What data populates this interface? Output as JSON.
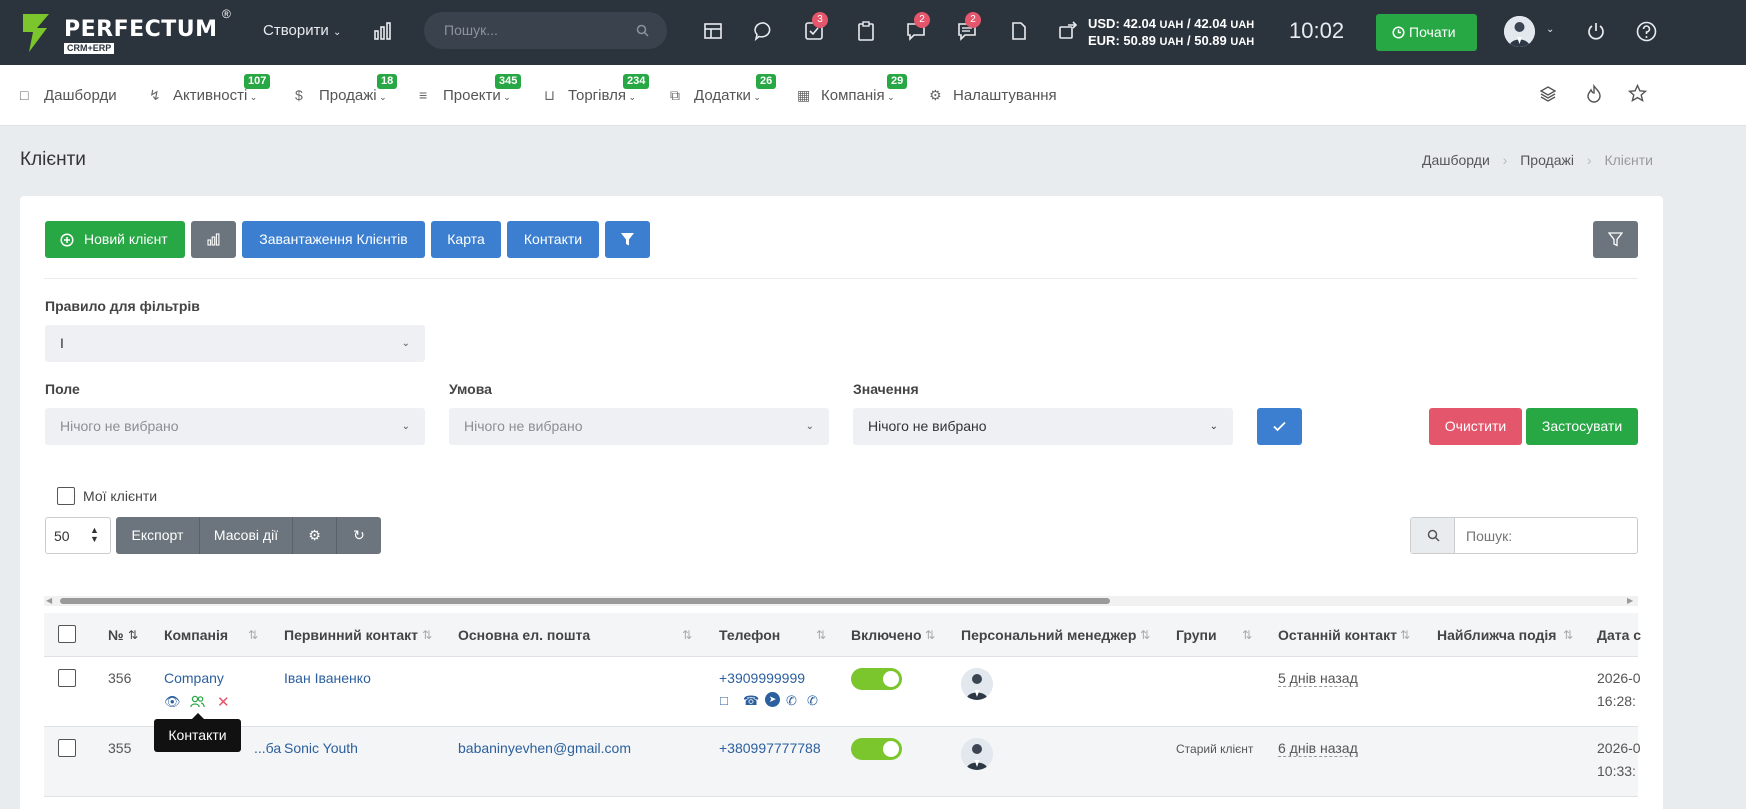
{
  "brand": {
    "name": "PERFECTUM",
    "reg": "®",
    "sub": "CRM+ERP",
    "color": "#7bc62d"
  },
  "topbar": {
    "create_label": "Створити",
    "search_placeholder": "Пошук...",
    "badges": {
      "tasks": "3",
      "messages": "2",
      "chat": "2"
    },
    "rates": {
      "usd": "USD: 42.04",
      "usd_unit": "UAH",
      "usd_sep": " / 42.04 ",
      "eur": "EUR: 50.89",
      "eur_sep": " / 50.89 "
    },
    "clock": "10:02",
    "start_label": "Почати"
  },
  "nav": {
    "items": [
      {
        "label": "Дашборди",
        "badge": ""
      },
      {
        "label": "Активності",
        "badge": "107"
      },
      {
        "label": "Продажі",
        "badge": "18"
      },
      {
        "label": "Проекти",
        "badge": "345"
      },
      {
        "label": "Торгівля",
        "badge": "234"
      },
      {
        "label": "Додатки",
        "badge": "26"
      },
      {
        "label": "Компанія",
        "badge": "29"
      },
      {
        "label": "Налаштування",
        "badge": ""
      }
    ]
  },
  "page": {
    "title": "Клієнти",
    "breadcrumb": [
      "Дашборди",
      "Продажі",
      "Клієнти"
    ]
  },
  "toolbar": {
    "new_client": "Новий клієнт",
    "load_clients": "Завантаження Клієнтів",
    "map": "Карта",
    "contacts": "Контакти"
  },
  "filters": {
    "rule_label": "Правило для фільтрів",
    "rule_value": "І",
    "field_label": "Поле",
    "condition_label": "Умова",
    "value_label": "Значення",
    "field_placeholder": "Нічого не вибрано",
    "condition_placeholder": "Нічого не вибрано",
    "value_value": "Нічого не вибрано",
    "clear": "Очистити",
    "apply": "Застосувати"
  },
  "table_controls": {
    "my_clients": "Мої клієнти",
    "page_size": "50",
    "export": "Експорт",
    "bulk": "Масові дії",
    "search_placeholder": "Пошук:"
  },
  "table": {
    "columns": [
      "№",
      "Компанія",
      "Первинний контакт",
      "Основна ел. пошта",
      "Телефон",
      "Включено",
      "Персональний менеджер",
      "Групи",
      "Останній контакт",
      "Найближча подія",
      "Дата с"
    ],
    "rows": [
      {
        "num": "356",
        "company": "Company",
        "contact": "Іван Іваненко",
        "email": "",
        "phone": "+3909999999",
        "enabled": true,
        "group": "",
        "last_contact": "5 днів назад",
        "date1": "2026-0",
        "date2": "16:28:"
      },
      {
        "num": "355",
        "company": "...ба",
        "contact": "Sonic Youth",
        "email": "babaninyevhen@gmail.com",
        "phone": "+380997777788",
        "enabled": true,
        "group": "Старий клієнт",
        "last_contact": "6 днів назад",
        "date1": "2026-0",
        "date2": "10:33:"
      }
    ],
    "tooltip": "Контакти"
  }
}
